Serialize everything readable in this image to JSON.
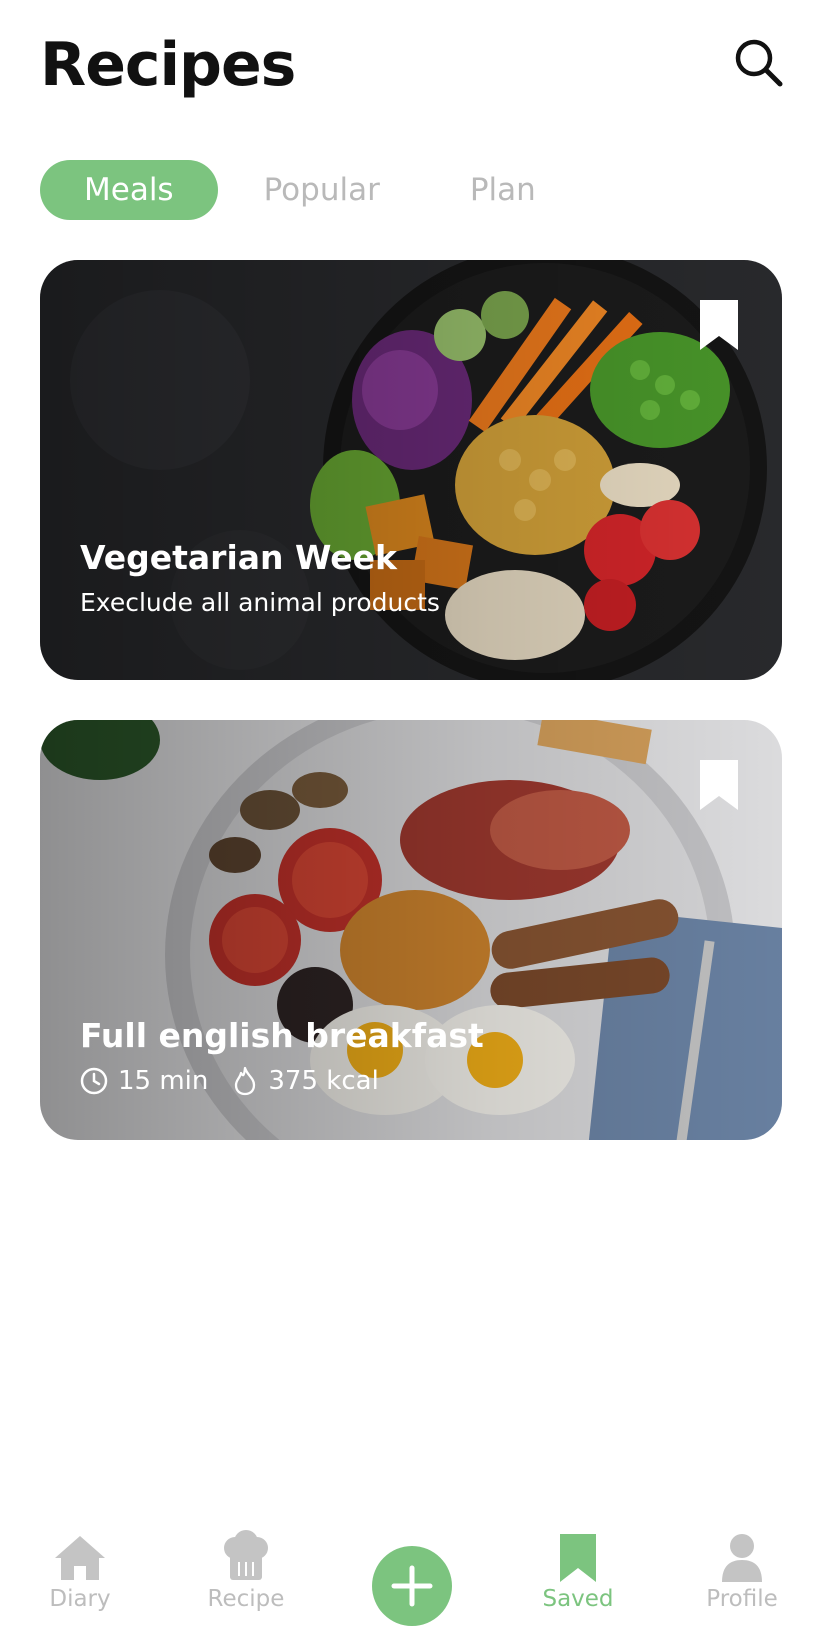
{
  "header": {
    "title": "Recipes",
    "search_icon": "search-icon"
  },
  "tabs": [
    {
      "label": "Meals",
      "active": true
    },
    {
      "label": "Popular",
      "active": false
    },
    {
      "label": "Plan",
      "active": false
    }
  ],
  "cards": [
    {
      "title": "Vegetarian Week",
      "subtitle": "Execlude all animal products",
      "bookmark_icon": "bookmark-icon"
    },
    {
      "title": "Full english breakfast",
      "time": "15 min",
      "calories": "375 kcal",
      "bookmark_icon": "bookmark-icon"
    }
  ],
  "bottom_nav": {
    "items": [
      {
        "label": "Diary",
        "icon": "home-icon",
        "active": false
      },
      {
        "label": "Recipe",
        "icon": "chef-hat-icon",
        "active": false
      },
      {
        "label": "Saved",
        "icon": "bookmark-icon",
        "active": true
      },
      {
        "label": "Profile",
        "icon": "user-icon",
        "active": false
      }
    ],
    "add_icon": "plus-icon"
  },
  "colors": {
    "accent": "#7cc47f",
    "inactive": "#bdbdbd",
    "text": "#111111"
  }
}
